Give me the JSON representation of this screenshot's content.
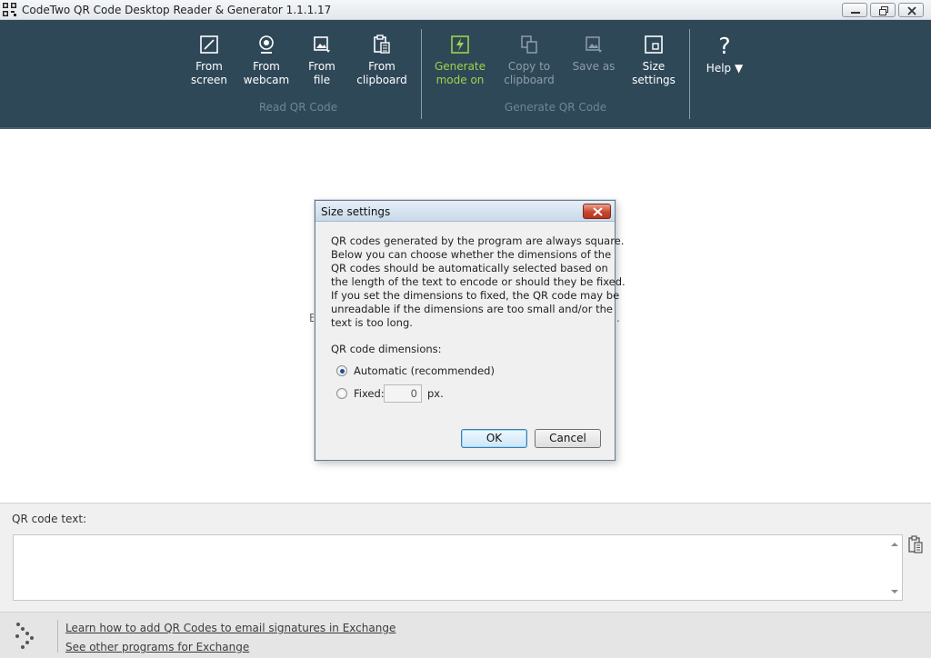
{
  "window": {
    "title": "CodeTwo QR Code Desktop Reader & Generator 1.1.1.17"
  },
  "toolbar": {
    "read_group_label": "Read QR Code",
    "generate_group_label": "Generate QR Code",
    "items": [
      {
        "line1": "From",
        "line2": "screen",
        "icon": "screen-capture-icon"
      },
      {
        "line1": "From",
        "line2": "webcam",
        "icon": "webcam-icon"
      },
      {
        "line1": "From",
        "line2": "file",
        "icon": "image-file-icon"
      },
      {
        "line1": "From",
        "line2": "clipboard",
        "icon": "clipboard-icon"
      },
      {
        "line1": "Generate",
        "line2": "mode on",
        "icon": "lightning-icon",
        "state": "active",
        "color": "#9fd24a"
      },
      {
        "line1": "Copy to",
        "line2": "clipboard",
        "icon": "copy-icon",
        "state": "disabled"
      },
      {
        "line1": "Save as",
        "line2": "",
        "icon": "save-image-icon",
        "state": "disabled"
      },
      {
        "line1": "Size",
        "line2": "settings",
        "icon": "size-settings-icon"
      }
    ],
    "help_label": "Help ▼"
  },
  "background_hint": {
    "left_fragment": "E",
    "right_fragment": "."
  },
  "dialog": {
    "title": "Size settings",
    "description_lines": [
      "QR codes generated by the program are always square.",
      "Below you can choose whether the dimensions of the",
      "QR codes should be automatically selected based on",
      "the length of the text to encode or should they be fixed.",
      "If you set the dimensions to fixed, the QR code may be",
      "unreadable if the dimensions are too small and/or the",
      "text is too long."
    ],
    "dimensions_label": "QR code dimensions:",
    "option_automatic": "Automatic (recommended)",
    "option_fixed": "Fixed:",
    "fixed_value": "0",
    "fixed_unit": "px.",
    "selected_option": "automatic",
    "ok_label": "OK",
    "cancel_label": "Cancel"
  },
  "qr_text": {
    "label": "QR code text:",
    "value": ""
  },
  "footer": {
    "link1": "Learn how to add QR Codes to email signatures in Exchange",
    "link2": "See other programs for Exchange"
  },
  "colors": {
    "toolbar_bg": "#2f4858",
    "active_accent": "#9fd24a",
    "disabled_text": "#8d9ea9"
  }
}
